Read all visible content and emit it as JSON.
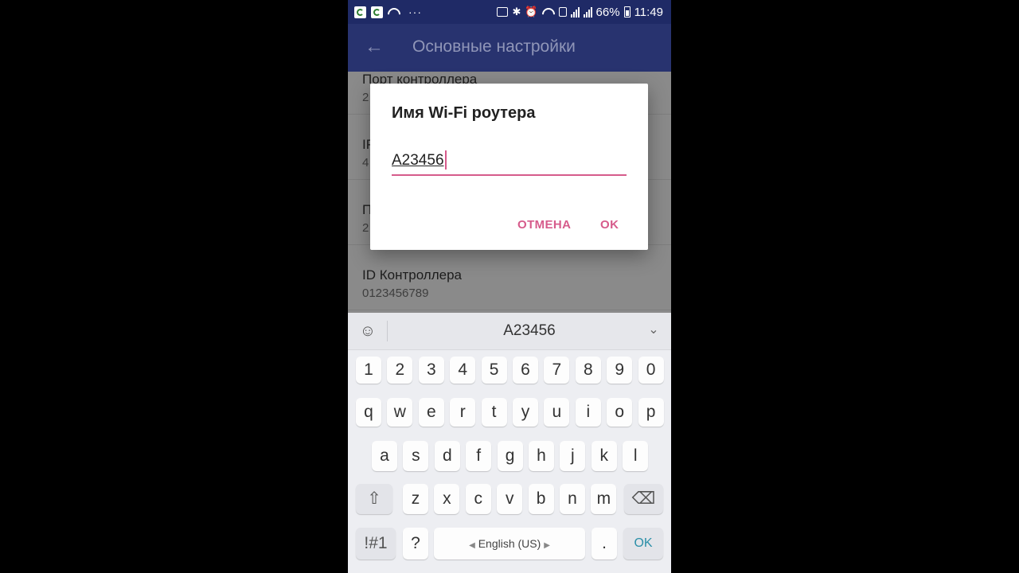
{
  "status_bar": {
    "battery": "66%",
    "time": "11:49",
    "dots": "···"
  },
  "app_bar": {
    "back_icon": "arrow-left-icon",
    "title": "Основные настройки"
  },
  "settings": [
    {
      "title": "Порт контроллера",
      "value": "2"
    },
    {
      "title": "IP",
      "value": "4"
    },
    {
      "title": "П",
      "value": "2"
    },
    {
      "title": "ID Контроллера",
      "value": "0123456789"
    }
  ],
  "dialog": {
    "title": "Имя Wi-Fi роутера",
    "input_value": "A23456",
    "cancel_label": "ОТМЕНА",
    "ok_label": "OK"
  },
  "keyboard": {
    "suggestion": "A23456",
    "numbers": [
      "1",
      "2",
      "3",
      "4",
      "5",
      "6",
      "7",
      "8",
      "9",
      "0"
    ],
    "row1": [
      "q",
      "w",
      "e",
      "r",
      "t",
      "y",
      "u",
      "i",
      "o",
      "p"
    ],
    "row2": [
      "a",
      "s",
      "d",
      "f",
      "g",
      "h",
      "j",
      "k",
      "l"
    ],
    "row3": [
      "z",
      "x",
      "c",
      "v",
      "b",
      "n",
      "m"
    ],
    "symbols_label": "!#1",
    "question_label": "?",
    "space_label": "English (US)",
    "period_label": ".",
    "ok_label": "OK"
  },
  "colors": {
    "accent": "#d65b8b",
    "app_bar": "#28336f",
    "status_bar": "#1f2a66"
  }
}
